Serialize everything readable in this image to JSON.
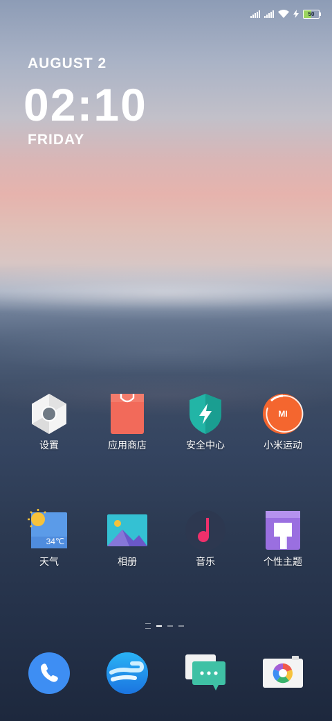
{
  "status_bar": {
    "battery_level": "50",
    "battery_fill": 0.5,
    "icons": [
      "signal-icon",
      "signal-icon",
      "wifi-icon",
      "charging-icon",
      "battery-icon"
    ]
  },
  "clock": {
    "date": "AUGUST 2",
    "time": "02:10",
    "day": "FRIDAY"
  },
  "apps": [
    {
      "label": "设置",
      "icon": "settings-icon"
    },
    {
      "label": "应用商店",
      "icon": "app-store-icon"
    },
    {
      "label": "安全中心",
      "icon": "security-icon"
    },
    {
      "label": "小米运动",
      "icon": "mi-fit-icon",
      "icon_text": "MI"
    },
    {
      "label": "天气",
      "icon": "weather-icon",
      "icon_text": "34℃"
    },
    {
      "label": "相册",
      "icon": "gallery-icon"
    },
    {
      "label": "音乐",
      "icon": "music-icon"
    },
    {
      "label": "个性主题",
      "icon": "themes-icon"
    }
  ],
  "page_indicator": {
    "pages": 3,
    "current": 1
  },
  "dock": [
    {
      "icon": "phone-icon"
    },
    {
      "icon": "browser-icon"
    },
    {
      "icon": "messages-icon"
    },
    {
      "icon": "camera-icon"
    }
  ],
  "colors": {
    "app_store": "#f26a5a",
    "security": "#22b5a6",
    "mi_fit": "#f4662f",
    "music_note": "#f0306b",
    "themes": "#9a6fe0",
    "phone": "#3e8ef3",
    "messages": "#3fc1a5"
  }
}
